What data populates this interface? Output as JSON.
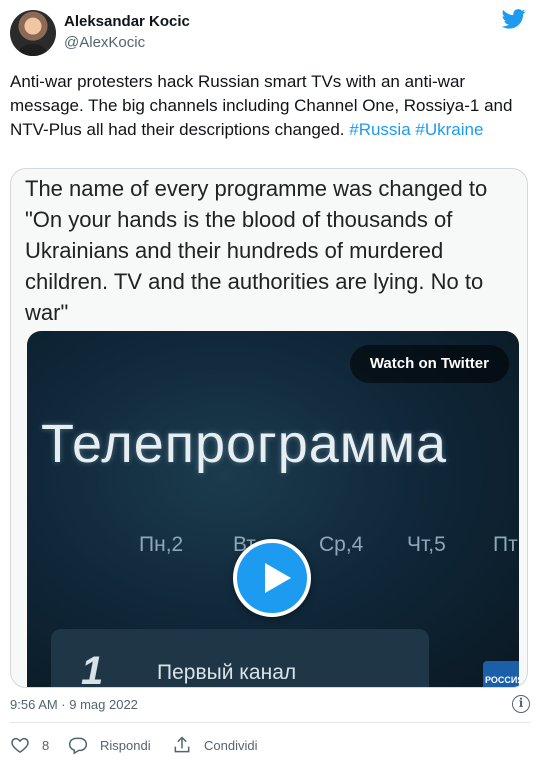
{
  "user": {
    "name": "Aleksandar Kocic",
    "handle": "@AlexKocic"
  },
  "tweet": {
    "text": "Anti-war protesters hack Russian smart TVs with an anti-war message. The big channels including Channel One, Rossiya-1 and NTV-Plus all had their descriptions changed. ",
    "hashtags": [
      "#Russia",
      "#Ukraine"
    ],
    "timestamp": "9:56 AM · 9 mag 2022"
  },
  "quoted_card": {
    "text": "The name of every programme was changed to \"On your hands is the blood of thousands of Ukrainians and their hundreds of murdered children. TV and the authorities are lying. No to war\""
  },
  "video": {
    "watch_label": "Watch on Twitter",
    "screen_title": "Телепрограмма",
    "days": [
      "Пн,2",
      "Вт",
      "Ср,4",
      "Чт,5",
      "Пт"
    ],
    "channel_logo": "1",
    "channel_name": "Первый канал",
    "side_badge": "РОССИЯ"
  },
  "actions": {
    "like_count": "8",
    "reply_label": "Rispondi",
    "share_label": "Condividi"
  },
  "colors": {
    "accent": "#1d9bf0",
    "muted": "#536471"
  }
}
